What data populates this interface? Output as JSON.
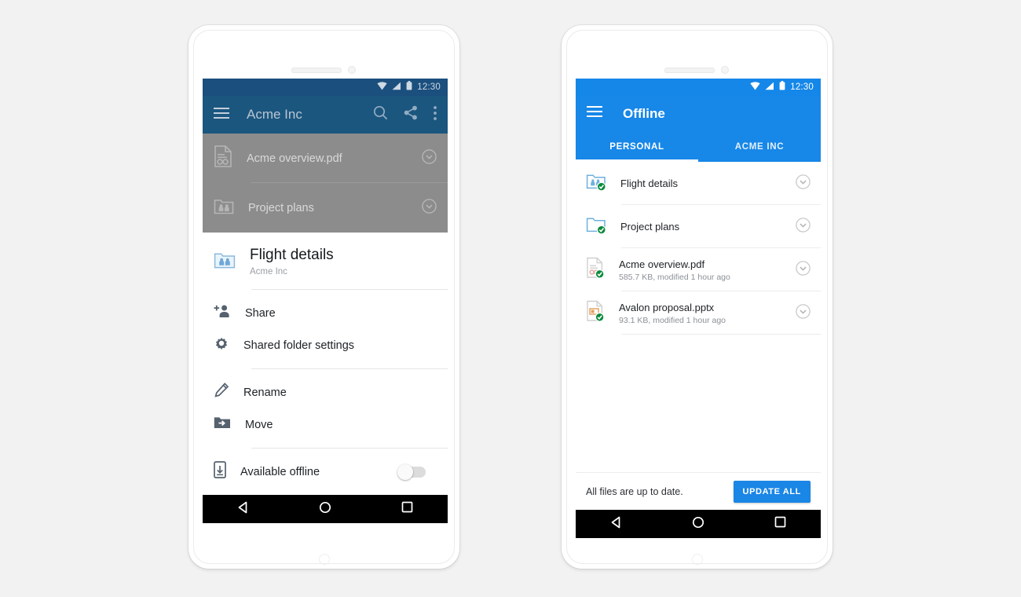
{
  "background_color": "#f2f2f2",
  "left_phone": {
    "status_bar": {
      "time": "12:30",
      "icons": [
        "wifi-icon",
        "signal-icon",
        "battery-icon"
      ]
    },
    "app_bar": {
      "menu_icon": "hamburger-menu-icon",
      "title": "Acme Inc",
      "actions": [
        "search-icon",
        "share-icon",
        "overflow-menu-icon"
      ]
    },
    "background_list": [
      {
        "icon": "pdf-file-icon",
        "label": "Acme overview.pdf",
        "action_icon": "chevron-down-circle-icon"
      },
      {
        "icon": "shared-folder-icon",
        "label": "Project plans",
        "action_icon": "chevron-down-circle-icon"
      }
    ],
    "bottom_sheet": {
      "header": {
        "icon": "shared-folder-icon",
        "title": "Flight details",
        "subtitle": "Acme Inc"
      },
      "groups": [
        [
          {
            "icon": "person-add-icon",
            "label": "Share"
          },
          {
            "icon": "gear-icon",
            "label": "Shared folder settings"
          }
        ],
        [
          {
            "icon": "pencil-icon",
            "label": "Rename"
          },
          {
            "icon": "folder-move-icon",
            "label": "Move"
          }
        ],
        [
          {
            "icon": "phone-download-icon",
            "label": "Available offline",
            "toggle": "off"
          }
        ]
      ]
    },
    "nav_bar": {
      "back": "back-triangle-icon",
      "home": "home-circle-icon",
      "recents": "recents-square-icon"
    }
  },
  "right_phone": {
    "status_bar": {
      "time": "12:30",
      "icons": [
        "wifi-icon",
        "signal-icon",
        "battery-icon"
      ]
    },
    "app_bar": {
      "menu_icon": "hamburger-menu-icon",
      "title": "Offline",
      "accent_color": "#1787e8",
      "tabs": [
        {
          "label": "PERSONAL",
          "active": true
        },
        {
          "label": "ACME INC",
          "active": false
        }
      ]
    },
    "list": [
      {
        "icon": "shared-folder-offline-icon",
        "name": "Flight details",
        "meta": "",
        "action_icon": "chevron-down-circle-icon"
      },
      {
        "icon": "folder-offline-icon",
        "name": "Project plans",
        "meta": "",
        "action_icon": "chevron-down-circle-icon"
      },
      {
        "icon": "pdf-file-offline-icon",
        "name": "Acme overview.pdf",
        "meta": "585.7 KB, modified 1 hour ago",
        "action_icon": "chevron-down-circle-icon"
      },
      {
        "icon": "pptx-file-offline-icon",
        "name": "Avalon proposal.pptx",
        "meta": "93.1 KB, modified 1 hour ago",
        "action_icon": "chevron-down-circle-icon"
      }
    ],
    "bottom_bar": {
      "message": "All files are up to date.",
      "button_label": "UPDATE ALL",
      "button_color": "#1a86e6"
    },
    "nav_bar": {
      "back": "back-triangle-icon",
      "home": "home-circle-icon",
      "recents": "recents-square-icon"
    }
  }
}
